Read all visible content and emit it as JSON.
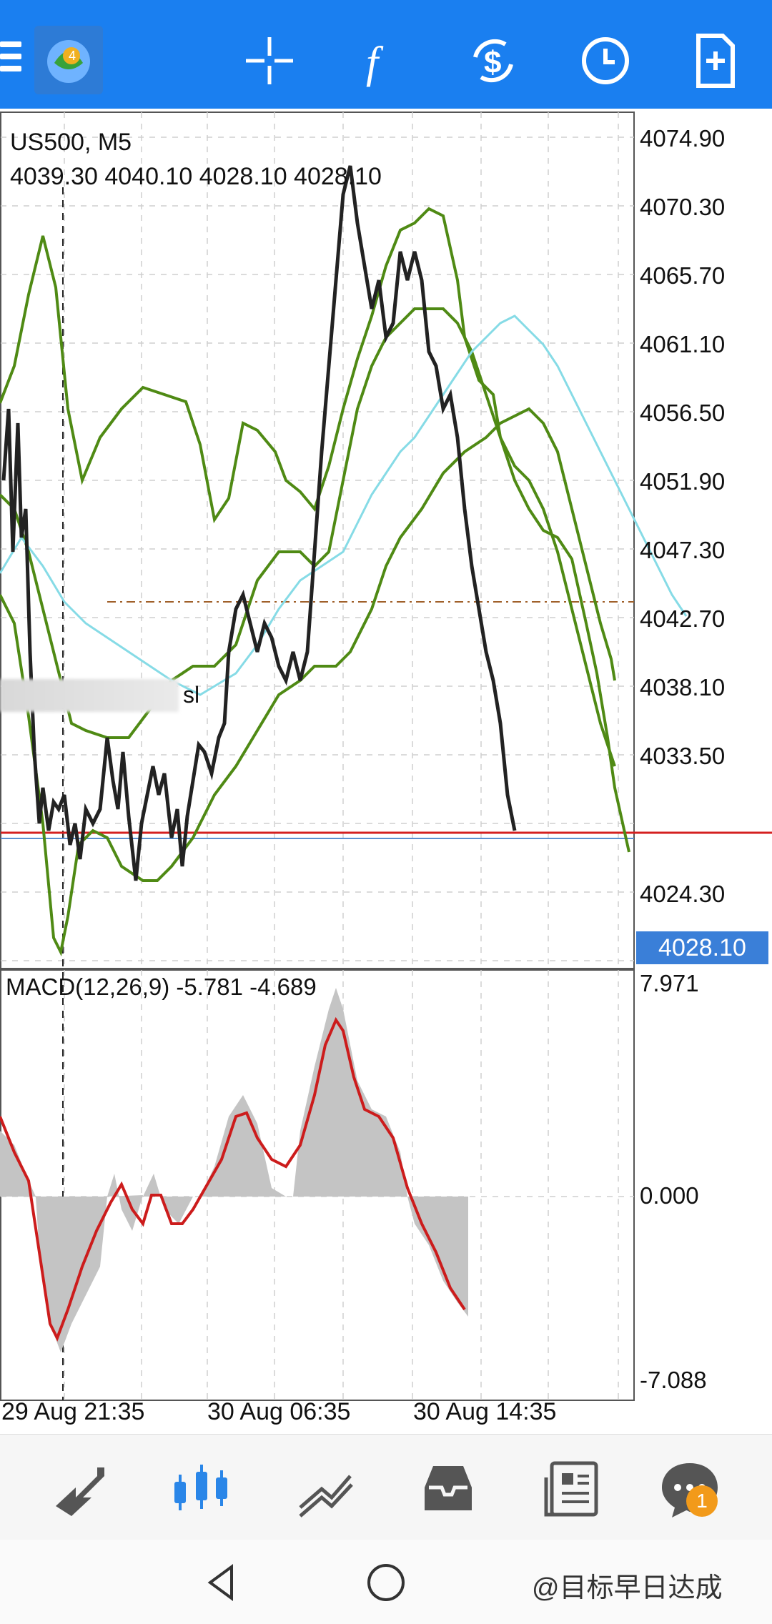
{
  "topbar": {
    "icons": [
      "menu-icon",
      "mt4-logo-icon",
      "crosshair-icon",
      "indicators-icon",
      "trade-icon",
      "clock-icon",
      "new-order-icon"
    ]
  },
  "chart": {
    "symbol_line": "US500, M5",
    "ohlc_line": "4039.30 4040.10 4028.10 4028.10",
    "price_labels": [
      "4074.90",
      "4070.30",
      "4065.70",
      "4061.10",
      "4056.50",
      "4051.90",
      "4047.30",
      "4042.70",
      "4038.10",
      "4033.50",
      "4024.30"
    ],
    "current_price": "4028.10",
    "sl_label": "sl",
    "macd_label": "MACD(12,26,9) -5.781 -4.689",
    "macd_levels": [
      "7.971",
      "0.000",
      "-7.088"
    ],
    "date_labels": [
      "29 Aug 21:35",
      "30 Aug 06:35",
      "30 Aug 14:35"
    ],
    "colors": {
      "bands": "#4f8a14",
      "ma": "#7fd9e6",
      "signal": "#cc1c1c",
      "hist": "#c4c4c4",
      "sl_line": "#a0602a",
      "bid_line": "#d42020"
    }
  },
  "bottomnav": {
    "icons": [
      "quotes-icon",
      "chart-icon",
      "trade-icon",
      "history-icon",
      "news-icon",
      "chat-icon"
    ],
    "chat_badge": "1"
  },
  "system": {
    "watermark": "@目标早日达成"
  }
}
